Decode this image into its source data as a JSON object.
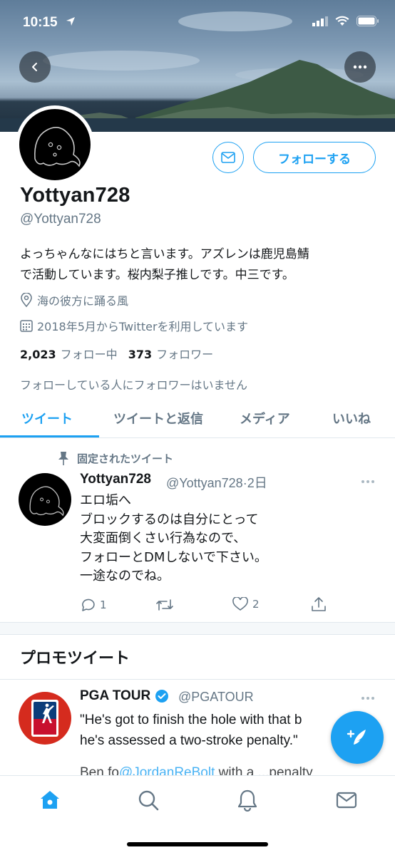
{
  "status_bar": {
    "time": "10:15"
  },
  "profile": {
    "name": "Yottyan728",
    "handle": "@Yottyan728",
    "bio_lines": [
      "よっちゃんなにはちと言います。アズレンは鹿児島鯖",
      "で活動しています。桜内梨子推しです。中三です。"
    ],
    "location": "海の彼方に踊る風",
    "joined": "2018年5月からTwitterを利用しています",
    "following_count": "2,023",
    "following_label": "フォロー中",
    "followers_count": "373",
    "followers_label": "フォロワー",
    "followers_you_know": "フォローしている人にフォロワーはいません",
    "follow_button_label": "フォローする"
  },
  "tabs": [
    {
      "label": "ツイート",
      "active": true
    },
    {
      "label": "ツイートと返信",
      "active": false
    },
    {
      "label": "メディア",
      "active": false
    },
    {
      "label": "いいね",
      "active": false
    }
  ],
  "pinned_tweet": {
    "pinned_label": "固定されたツイート",
    "author_name": "Yottyan728",
    "author_handle": "@Yottyan728",
    "time": "2日",
    "lines": [
      "エロ垢へ",
      "ブロックするのは自分にとって",
      "大変面倒くさい行為なので、",
      "フォローとDMしないで下さい。",
      "一途なのでね。"
    ],
    "reply_count": "1",
    "like_count": "2"
  },
  "promoted": {
    "section_title": "プロモツイート",
    "author_name": "PGA TOUR",
    "author_handle": "@PGATOUR",
    "avatar_text": "PGA TOUR",
    "lines": [
      "\"He's got to finish the hole with that b",
      "he's assessed a two-stroke penalty.\""
    ],
    "cut_line_prefix": "Ben fo",
    "cut_line_link": "@JordanReBolt",
    "cut_line_suffix": " with a ...penalty"
  },
  "colors": {
    "accent": "#1da1f2",
    "secondary_text": "#657786",
    "divider": "#e1e8ed"
  },
  "icons": [
    "back-icon",
    "more-icon",
    "mail-icon",
    "location-icon",
    "calendar-icon",
    "pin-icon",
    "reply-icon",
    "retweet-icon",
    "like-icon",
    "share-icon",
    "compose-icon",
    "home-icon",
    "search-icon",
    "notifications-icon",
    "messages-icon",
    "verified-icon"
  ]
}
